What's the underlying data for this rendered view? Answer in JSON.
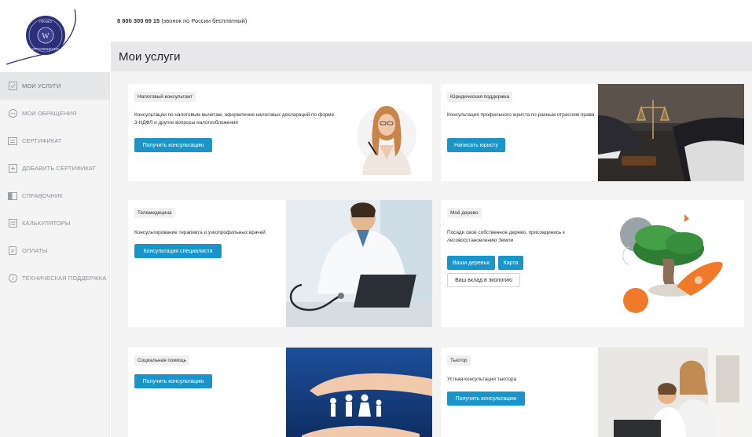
{
  "logo": {
    "text_top": "ПРАВО",
    "text_bottom": "ПРОСВЕЩЕНИЯ"
  },
  "sidebar": {
    "items": [
      {
        "label": "МОИ УСЛУГИ",
        "icon": "check-square-icon"
      },
      {
        "label": "МОИ ОБРАЩЕНИЯ",
        "icon": "chat-bubble-icon"
      },
      {
        "label": "СЕРТИФИКАТ",
        "icon": "certificate-icon"
      },
      {
        "label": "ДОБАВИТЬ СЕРТИФИКАТ",
        "icon": "plus-square-icon"
      },
      {
        "label": "СПРАВОЧНИК",
        "icon": "book-icon"
      },
      {
        "label": "КАЛЬКУЛЯТОРЫ",
        "icon": "calculator-icon"
      },
      {
        "label": "ОПЛАТЫ",
        "icon": "receipt-icon"
      },
      {
        "label": "ТЕХНИЧЕСКАЯ ПОДДЕРЖКА",
        "icon": "info-circle-icon"
      }
    ]
  },
  "header": {
    "phone": "8 800 300 69 15",
    "phone_note": "(звонок по России бесплатный)"
  },
  "page_title": "Мои услуги",
  "cards": {
    "tax": {
      "tag": "Налоговый консультант",
      "desc": "Консультации по налоговым вычетам, оформление налоговых деклараций по форме 3-НДФЛ и другие вопросы налогообложения",
      "button": "Получить консультацию"
    },
    "legal": {
      "tag": "Юридическая поддержка",
      "desc": "Консультация профильного юриста по разным отраслям права",
      "button": "Написать юристу"
    },
    "tele": {
      "tag": "Телемедицина",
      "desc": "Консультирование терапевта и узкопрофильных врачей",
      "button": "Консультация специалиста"
    },
    "tree": {
      "tag": "Моё дерево",
      "desc": "Посади своё собственное дерево, присоединись к лесовосстановлению Земли",
      "button1": "Ваши деревья",
      "button2": "Карта",
      "button3": "Ваш вклад в экологию"
    },
    "social": {
      "tag": "Социальная помощь",
      "button": "Получить консультацию"
    },
    "tutor": {
      "tag": "Тьютор",
      "desc": "Устная консультация тьютора",
      "button": "Получить консультацию"
    }
  },
  "colors": {
    "accent": "#1a95c9",
    "sidebar_bg": "#f4f4f5",
    "page_bg": "#f3f3f4"
  }
}
